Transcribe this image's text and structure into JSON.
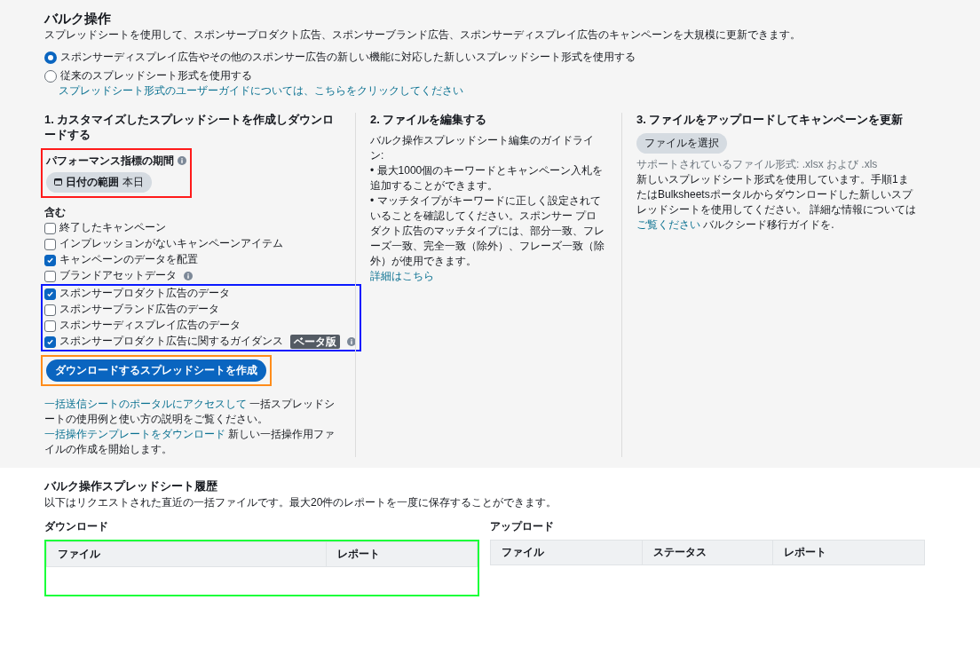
{
  "bulk": {
    "title": "バルク操作",
    "description": "スプレッドシートを使用して、スポンサープロダクト広告、スポンサーブランド広告、スポンサーディスプレイ広告のキャンペーンを大規模に更新できます。",
    "format_options": [
      {
        "label": "スポンサーディスプレイ広告やその他のスポンサー広告の新しい機能に対応した新しいスプレッドシート形式を使用する",
        "selected": true
      },
      {
        "label": "従来のスプレッドシート形式を使用する",
        "selected": false
      }
    ],
    "format_guide_link": "スプレッドシート形式のユーザーガイドについては、こちらをクリックしてください",
    "steps": [
      {
        "heading": "1. カスタマイズしたスプレッドシートを作成しダウンロードする",
        "period": {
          "label": "パフォーマンス指標の期間",
          "button_label": "日付の範囲",
          "button_value": "本日",
          "highlighted": true
        },
        "include_label": "含む",
        "options": [
          {
            "label": "終了したキャンペーン",
            "checked": false,
            "info": false
          },
          {
            "label": "インプレッションがないキャンペーンアイテム",
            "checked": false,
            "info": false
          },
          {
            "label": "キャンペーンのデータを配置",
            "checked": true,
            "info": false
          },
          {
            "label": "ブランドアセットデータ",
            "checked": false,
            "info": true
          }
        ],
        "ad_options": {
          "highlighted": true,
          "items": [
            {
              "label": "スポンサープロダクト広告のデータ",
              "checked": true,
              "info": false
            },
            {
              "label": "スポンサーブランド広告のデータ",
              "checked": false,
              "info": false
            },
            {
              "label": "スポンサーディスプレイ広告のデータ",
              "checked": false,
              "info": false
            },
            {
              "label": "スポンサープロダクト広告に関するガイダンス",
              "checked": true,
              "badge": "ベータ版",
              "info": true
            }
          ]
        },
        "create_button": {
          "label": "ダウンロードするスプレッドシートを作成",
          "highlighted": true
        },
        "note": [
          {
            "kind": "link",
            "text": "一括送信シートのポータルにアクセスして"
          },
          {
            "kind": "text",
            "text": " 一括スプレッドシートの使用例と使い方の説明をご覧ください。 "
          },
          {
            "kind": "link",
            "text": "一括操作テンプレートをダウンロード"
          },
          {
            "kind": "text",
            "text": " 新しい一括操作用ファイルの作成を開始します。"
          }
        ]
      },
      {
        "heading": "2. ファイルを編集する",
        "intro": "バルク操作スプレッドシート編集のガイドライン:",
        "bullets": [
          "最大1000個のキーワードとキャンペーン入札を追加することができます。",
          "マッチタイプがキーワードに正しく設定されていることを確認してください。スポンサー プロダクト広告のマッチタイプには、部分一致、フレーズ一致、完全一致（除外）、フレーズ一致（除外）が使用できます。"
        ],
        "bullet_mark": "•",
        "link": "詳細はこちら"
      },
      {
        "heading": "3. ファイルをアップロードしてキャンペーンを更新",
        "file_button": "ファイルを選択",
        "hint": "サポートされているファイル形式: .xlsx および .xls",
        "note": [
          {
            "kind": "text",
            "text": "新しいスプレッドシート形式を使用しています。手順1またはBulksheetsポータルからダウンロードした新しいスプレッドシートを使用してください。 詳細な情報については "
          },
          {
            "kind": "link",
            "text": "ご覧ください"
          },
          {
            "kind": "text",
            "text": " バルクシード移行ガイドを."
          }
        ]
      }
    ]
  },
  "history": {
    "title": "バルク操作スプレッドシート履歴",
    "description": "以下はリクエストされた直近の一括ファイルです。最大20件のレポートを一度に保存することができます。",
    "downloads": {
      "label": "ダウンロード",
      "columns": [
        "ファイル",
        "レポート"
      ],
      "highlighted": true
    },
    "uploads": {
      "label": "アップロード",
      "columns": [
        "ファイル",
        "ステータス",
        "レポート"
      ]
    }
  }
}
